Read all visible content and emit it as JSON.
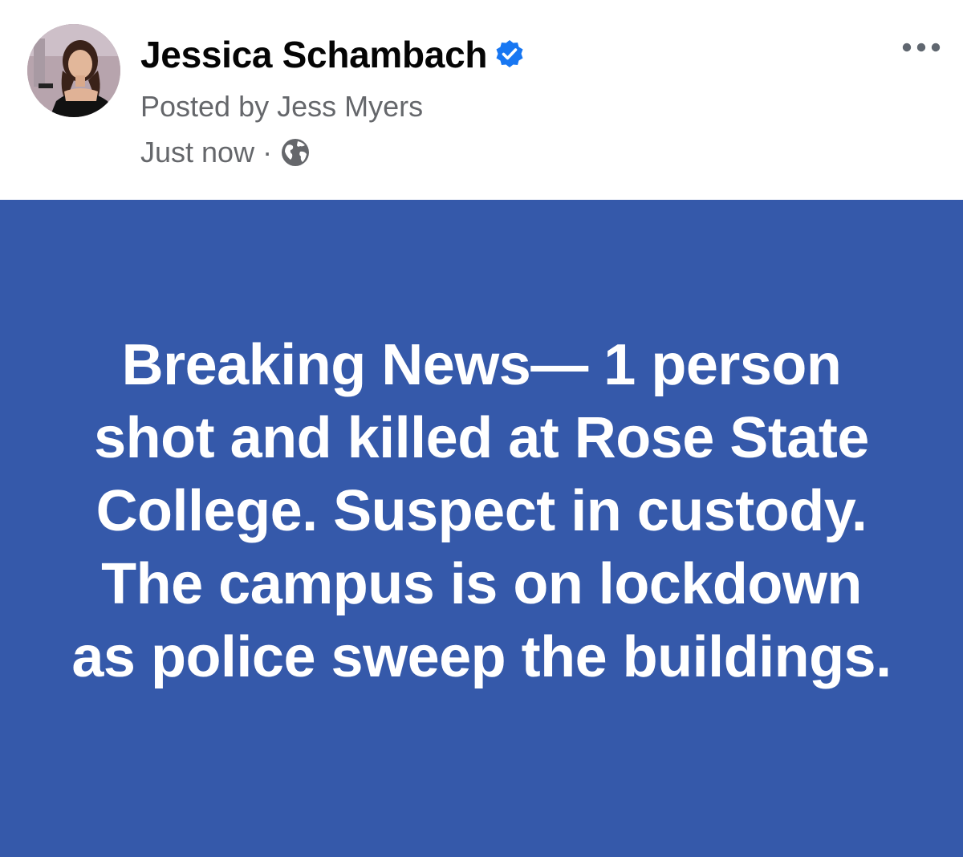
{
  "post": {
    "author": {
      "name": "Jessica Schambach",
      "verified": true,
      "avatar_icon": "profile-photo"
    },
    "posted_by": "Posted by Jess Myers",
    "timestamp": "Just now",
    "separator": "·",
    "audience_icon": "globe-icon",
    "more_icon": "more-options-icon",
    "content": {
      "text": "Breaking News— 1 person shot and killed at Rose State College. Suspect in custody. The campus is on lockdown as police sweep the buildings.",
      "background_color": "#3559aa",
      "text_color": "#ffffff"
    }
  },
  "colors": {
    "verified_badge": "#1877f2",
    "secondary_text": "#65676b",
    "primary_text": "#050505"
  }
}
